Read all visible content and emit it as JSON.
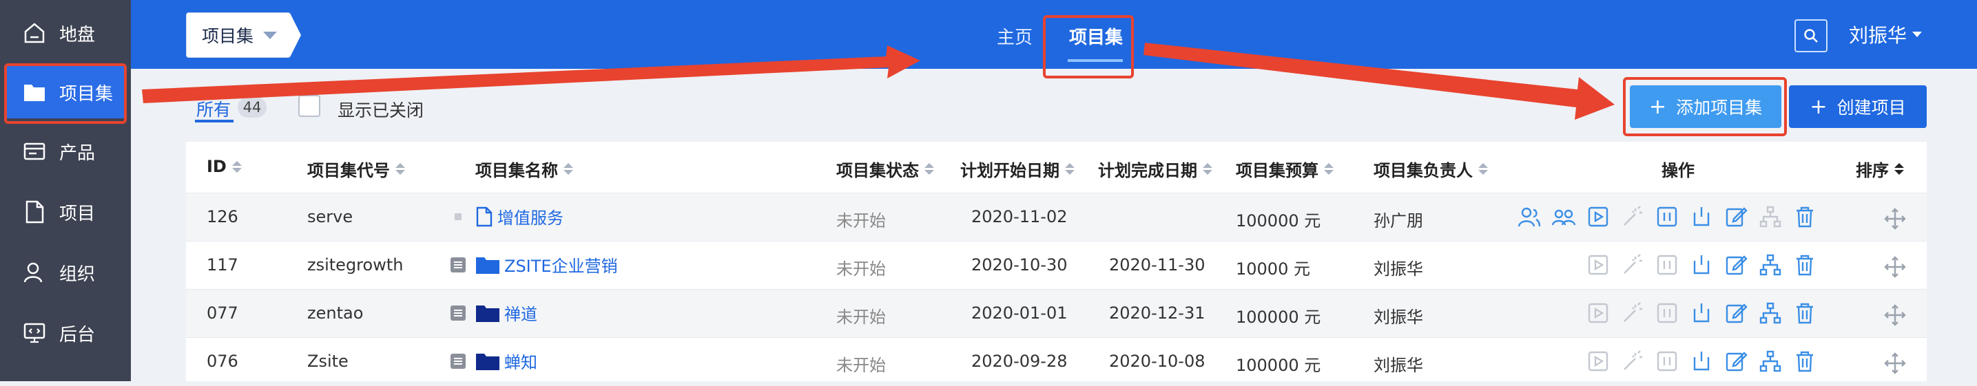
{
  "sidebar": {
    "items": [
      {
        "label": "地盘",
        "icon": "home-icon"
      },
      {
        "label": "项目集",
        "icon": "folder-icon"
      },
      {
        "label": "产品",
        "icon": "product-icon"
      },
      {
        "label": "项目",
        "icon": "file-icon"
      },
      {
        "label": "组织",
        "icon": "user-icon"
      },
      {
        "label": "后台",
        "icon": "monitor-icon"
      }
    ]
  },
  "header": {
    "crumb": "项目集",
    "nav_home": "主页",
    "nav_current": "项目集",
    "user": "刘振华"
  },
  "filter": {
    "all_label": "所有",
    "count": "44",
    "show_closed": "显示已关闭"
  },
  "actions": {
    "add_program": "添加项目集",
    "create_project": "创建项目"
  },
  "table": {
    "headers": {
      "id": "ID",
      "code": "项目集代号",
      "name": "项目集名称",
      "status": "项目集状态",
      "start": "计划开始日期",
      "end": "计划完成日期",
      "budget": "项目集预算",
      "owner": "项目集负责人",
      "ops": "操作",
      "order": "排序"
    },
    "rows": [
      {
        "id": "126",
        "code": "serve",
        "name": "增值服务",
        "status": "未开始",
        "start": "2020-11-02",
        "end": "",
        "budget": "100000 元",
        "owner": "孙广朋"
      },
      {
        "id": "117",
        "code": "zsitegrowth",
        "name": "ZSITE企业营销",
        "status": "未开始",
        "start": "2020-10-30",
        "end": "2020-11-30",
        "budget": "10000 元",
        "owner": "刘振华"
      },
      {
        "id": "077",
        "code": "zentao",
        "name": "禅道",
        "status": "未开始",
        "start": "2020-01-01",
        "end": "2020-12-31",
        "budget": "100000 元",
        "owner": "刘振华"
      },
      {
        "id": "076",
        "code": "Zsite",
        "name": "蝉知",
        "status": "未开始",
        "start": "2020-09-28",
        "end": "2020-10-08",
        "budget": "100000 元",
        "owner": "刘振华"
      }
    ]
  },
  "colors": {
    "primary": "#1f68e0",
    "sidebar": "#3d4352",
    "highlight": "#e8432f"
  }
}
